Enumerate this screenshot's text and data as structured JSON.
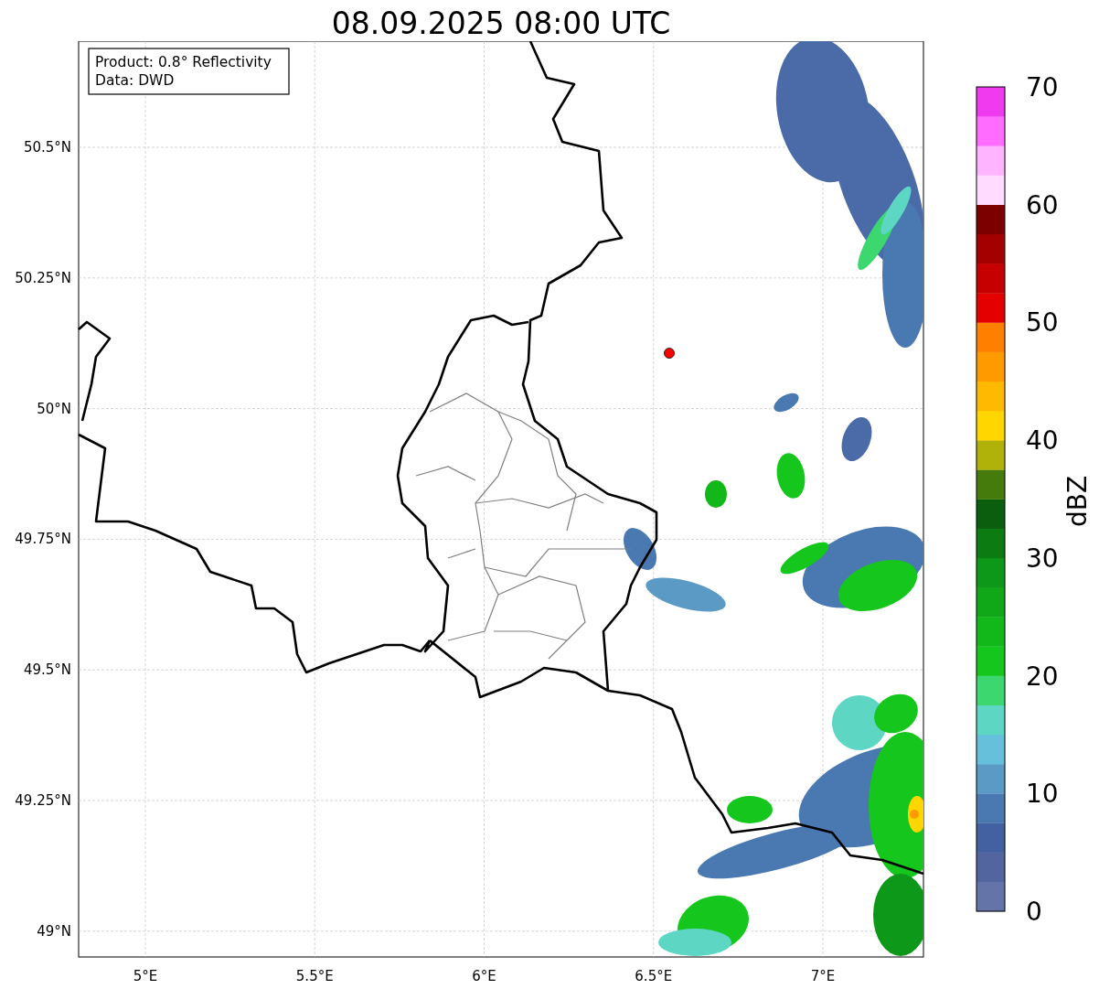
{
  "title": "08.09.2025 08:00 UTC",
  "legend": [
    "Product: 0.8° Reflectivity",
    "Data: DWD"
  ],
  "map": {
    "xticks": [
      "5°E",
      "5.5°E",
      "6°E",
      "6.5°E",
      "7°E"
    ],
    "yticks": [
      "50.5°N",
      "50.25°N",
      "50°N",
      "49.75°N",
      "49.5°N",
      "49.25°N",
      "49°N"
    ]
  },
  "colorbar": {
    "label": "dBZ",
    "ticks": [
      "70",
      "60",
      "50",
      "40",
      "30",
      "20",
      "10",
      "0"
    ],
    "bands": [
      {
        "color": "#6574a8"
      },
      {
        "color": "#52659e"
      },
      {
        "color": "#4360a0"
      },
      {
        "color": "#4a78b0"
      },
      {
        "color": "#5a9ac5"
      },
      {
        "color": "#66c0dc"
      },
      {
        "color": "#5ed6c4"
      },
      {
        "color": "#3dd76f"
      },
      {
        "color": "#15c61c"
      },
      {
        "color": "#12b81a"
      },
      {
        "color": "#10a818"
      },
      {
        "color": "#0e981a"
      },
      {
        "color": "#0c7c12"
      },
      {
        "color": "#0a5e0e"
      },
      {
        "color": "#457a0c"
      },
      {
        "color": "#b0b20a"
      },
      {
        "color": "#ffd600"
      },
      {
        "color": "#ffb900"
      },
      {
        "color": "#ff9a00"
      },
      {
        "color": "#ff7f00"
      },
      {
        "color": "#e50000"
      },
      {
        "color": "#c60000"
      },
      {
        "color": "#a40000"
      },
      {
        "color": "#7c0000"
      },
      {
        "color": "#ffdcff"
      },
      {
        "color": "#ffb4ff"
      },
      {
        "color": "#ff6cff"
      },
      {
        "color": "#ef3af0"
      }
    ]
  }
}
